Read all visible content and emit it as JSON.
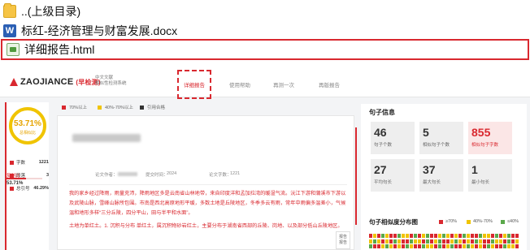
{
  "files": [
    {
      "name": "..(上级目录)",
      "icon": "folder-icon"
    },
    {
      "name": "标红-经济管理与财富发展.docx",
      "icon": "word-doc-icon"
    },
    {
      "name": "详细报告.html",
      "icon": "html-file-icon"
    }
  ],
  "report": {
    "logo": "ZAOJIANCE",
    "logo_tag": "(早检测)",
    "sub_tag_1": "中文文献",
    "sub_tag_2": "相似性检测系统",
    "nav": [
      "详细报告",
      "使用帮助",
      "再测一次",
      "再版报告"
    ],
    "active_nav": "详细报告",
    "summary": {
      "percent": "53.71%",
      "percent_label": "总相似比",
      "stats": [
        {
          "label": "字数",
          "value": "1221"
        },
        {
          "label": "段落",
          "value": "3"
        },
        {
          "label": "总引号",
          "value": "46.29%"
        }
      ],
      "duplicate_label": "复制比",
      "duplicate_value": "53.71%",
      "duplicate_ratio": 0.5371
    },
    "legend": [
      {
        "label": "70%以上",
        "color": "#d9282f"
      },
      {
        "label": "40%-70%以上",
        "color": "#f0c400"
      },
      {
        "label": "引用合格",
        "color": "#333333"
      }
    ],
    "doc": {
      "meta_author": "论文作者：",
      "meta_date_label": "提交时间：",
      "meta_date_value": "2024",
      "meta_words": "论文字数：",
      "meta_words_value": "1221",
      "paragraph_1": "我的家乡经过降雨，雨量充沛，降雨地区多是云南省山林地带，来自印度洋和孟加拉湾的暖湿气流。沅江下游和蒲溪市下游以及武陵山脉，雪峰山脉所包围。市南是西北高原地形平缓，多数土地是丘陵地区，冬季多云有雨，常年中雨偏多温差小，气候温和地形多样“三分丘陵，四分平山，田与半平和水面”。",
      "paragraph_2": "土地为单红土。1. 沉积与分布 单红土，属沉积物砂岩红土，主要分布于湖南省西部的丘陵、岗地、以及部分低山丘陵地区。",
      "badge": "报告 报告"
    },
    "info": {
      "title": "句子信息",
      "cards": [
        {
          "value": "46",
          "label": "句子个数"
        },
        {
          "value": "5",
          "label": "相似句子个数"
        },
        {
          "value": "855",
          "label": "相似句子字数"
        },
        {
          "value": "27",
          "label": "平均句长"
        },
        {
          "value": "37",
          "label": "最大句长"
        },
        {
          "value": "1",
          "label": "最小句长"
        }
      ],
      "dist_title": "句子相似度分布图",
      "dist_legend": [
        {
          "label": "≥70%",
          "color": "#d9282f"
        },
        {
          "label": "40%-70%",
          "color": "#f0c400"
        },
        {
          "label": "≤40%",
          "color": "#5aa84a"
        }
      ]
    }
  },
  "colors": {
    "accent": "#d9282f",
    "yellow": "#f0c400",
    "green": "#5aa84a"
  }
}
